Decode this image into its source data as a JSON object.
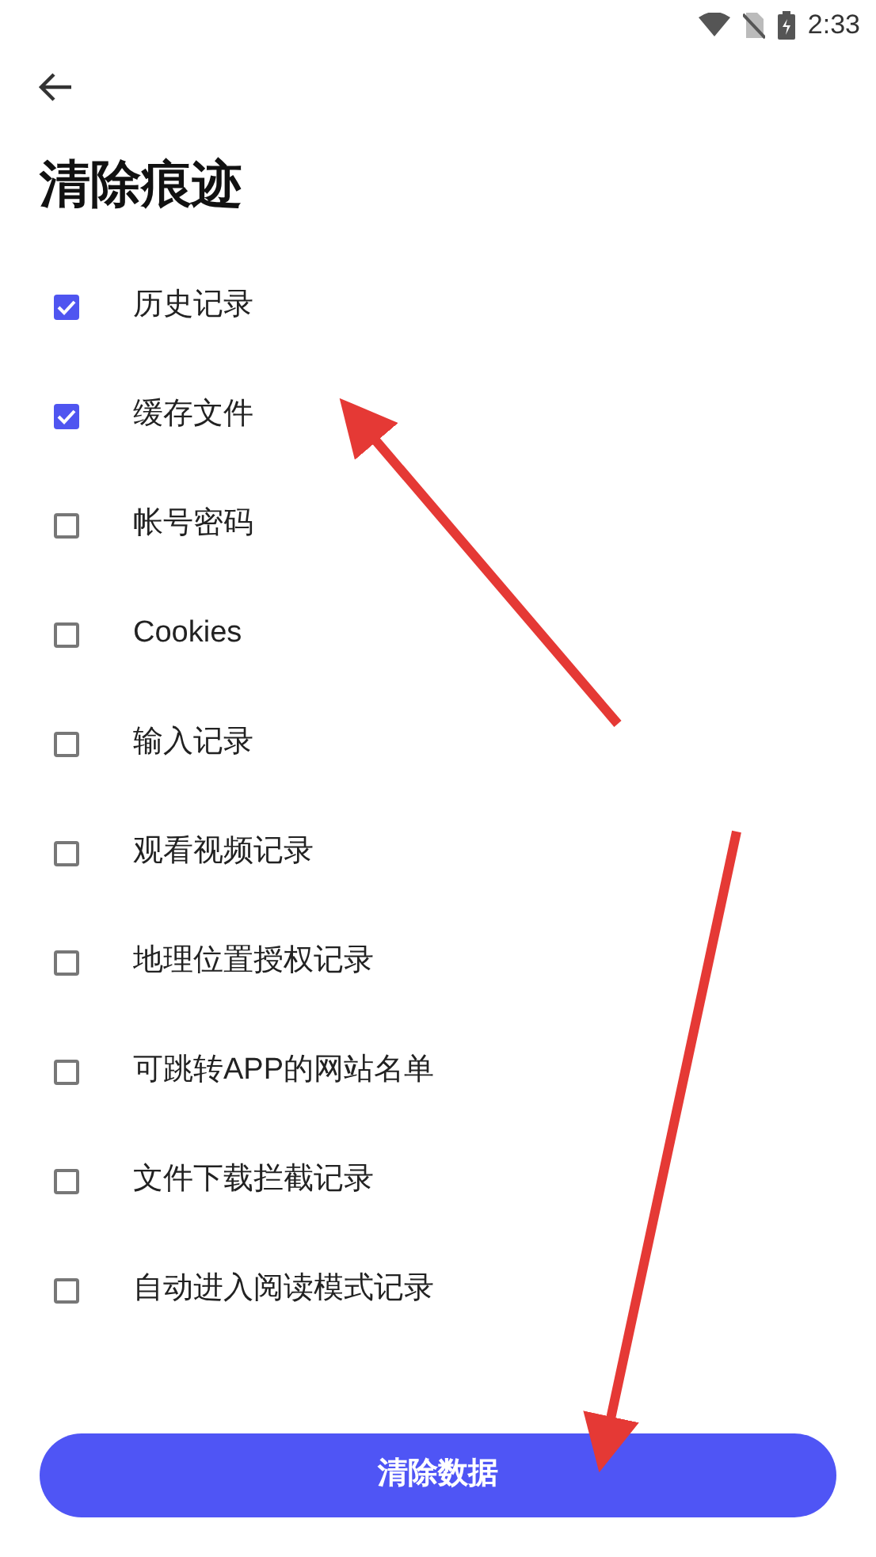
{
  "status_bar": {
    "time": "2:33"
  },
  "title": "清除痕迹",
  "options": [
    {
      "label": "历史记录",
      "checked": true
    },
    {
      "label": "缓存文件",
      "checked": true
    },
    {
      "label": "帐号密码",
      "checked": false
    },
    {
      "label": "Cookies",
      "checked": false
    },
    {
      "label": "输入记录",
      "checked": false
    },
    {
      "label": "观看视频记录",
      "checked": false
    },
    {
      "label": "地理位置授权记录",
      "checked": false
    },
    {
      "label": "可跳转APP的网站名单",
      "checked": false
    },
    {
      "label": "文件下载拦截记录",
      "checked": false
    },
    {
      "label": "自动进入阅读模式记录",
      "checked": false
    }
  ],
  "clear_button": "清除数据"
}
